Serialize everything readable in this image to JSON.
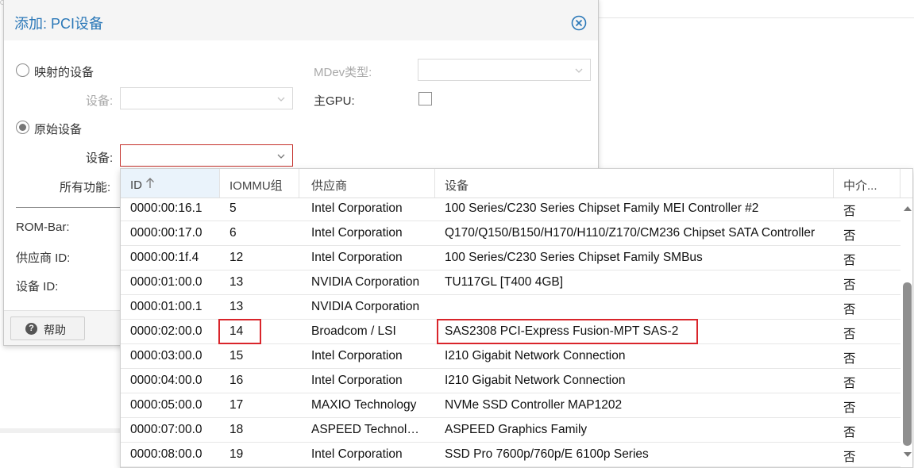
{
  "dialog": {
    "title": "添加: PCI设备",
    "mapped_device_label": "映射的设备",
    "mapped_device_select_label": "设备:",
    "raw_device_label": "原始设备",
    "raw_device_select_label": "设备:",
    "all_functions_label": "所有功能:",
    "mdev_type_label": "MDev类型:",
    "primary_gpu_label": "主GPU:",
    "rom_bar_label": "ROM-Bar:",
    "vendor_id_label": "供应商 ID:",
    "device_id_label": "设备 ID:",
    "help_button_label": "帮助",
    "mode_selected": "原始设备"
  },
  "grid": {
    "columns": [
      "ID",
      "IOMMU组",
      "供应商",
      "设备",
      "中介..."
    ],
    "sorted_column": "ID",
    "sort_direction": "ascending",
    "rows": [
      {
        "id": "0000:00:16.1",
        "iommu": "5",
        "vendor": "Intel Corporation",
        "device": "100 Series/C230 Series Chipset Family MEI Controller #2",
        "mdev": "否"
      },
      {
        "id": "0000:00:17.0",
        "iommu": "6",
        "vendor": "Intel Corporation",
        "device": "Q170/Q150/B150/H170/H110/Z170/CM236 Chipset SATA Controller",
        "mdev": "否"
      },
      {
        "id": "0000:00:1f.4",
        "iommu": "12",
        "vendor": "Intel Corporation",
        "device": "100 Series/C230 Series Chipset Family SMBus",
        "mdev": "否"
      },
      {
        "id": "0000:01:00.0",
        "iommu": "13",
        "vendor": "NVIDIA Corporation",
        "device": "TU117GL [T400 4GB]",
        "mdev": "否"
      },
      {
        "id": "0000:01:00.1",
        "iommu": "13",
        "vendor": "NVIDIA Corporation",
        "device": "",
        "mdev": "否"
      },
      {
        "id": "0000:02:00.0",
        "iommu": "14",
        "vendor": "Broadcom / LSI",
        "device": "SAS2308 PCI-Express Fusion-MPT SAS-2",
        "mdev": "否"
      },
      {
        "id": "0000:03:00.0",
        "iommu": "15",
        "vendor": "Intel Corporation",
        "device": "I210 Gigabit Network Connection",
        "mdev": "否"
      },
      {
        "id": "0000:04:00.0",
        "iommu": "16",
        "vendor": "Intel Corporation",
        "device": "I210 Gigabit Network Connection",
        "mdev": "否"
      },
      {
        "id": "0000:05:00.0",
        "iommu": "17",
        "vendor": "MAXIO Technology",
        "device": "NVMe SSD Controller MAP1202",
        "mdev": "否"
      },
      {
        "id": "0000:07:00.0",
        "iommu": "18",
        "vendor": "ASPEED Technology",
        "device": "ASPEED Graphics Family",
        "mdev": "否"
      },
      {
        "id": "0000:08:00.0",
        "iommu": "19",
        "vendor": "Intel Corporation",
        "device": "SSD Pro 7600p/760p/E 6100p Series",
        "mdev": "否"
      }
    ],
    "highlighted_row_id": "0000:02:00.0"
  },
  "colors": {
    "title": "#2b78b8",
    "highlight_border": "#d9252b",
    "sorted_header_bg": "#eaf3fb"
  },
  "icons": {
    "close": "close-circle-icon",
    "help": "question-circle-icon",
    "sort": "arrow-up-icon",
    "dropdown": "chevron-down-icon"
  }
}
